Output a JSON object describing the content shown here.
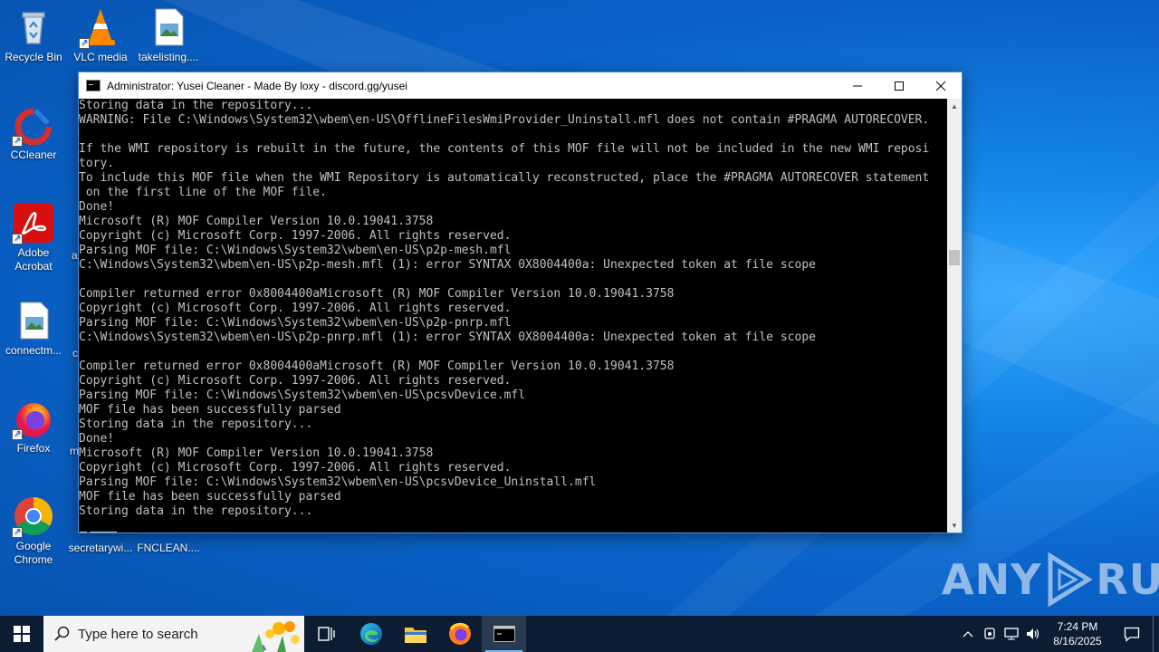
{
  "desktop": {
    "icons": [
      {
        "label": "Recycle Bin"
      },
      {
        "label": "VLC media"
      },
      {
        "label": "takelisting...."
      },
      {
        "label": "CCleaner"
      },
      {
        "label": "Adobe Acrobat"
      },
      {
        "label": "connectm..."
      },
      {
        "label": "Firefox"
      },
      {
        "label": "Google Chrome"
      },
      {
        "label": "secretarywi..."
      },
      {
        "label": "FNCLEAN...."
      }
    ],
    "cut_labels": [
      "a",
      "c",
      "m"
    ]
  },
  "window": {
    "title": "Administrator:  Yusei Cleaner - Made By loxy - discord.gg/yusei",
    "console_lines": [
      "Storing data in the repository...",
      "WARNING: File C:\\Windows\\System32\\wbem\\en-US\\OfflineFilesWmiProvider_Uninstall.mfl does not contain #PRAGMA AUTORECOVER.",
      "",
      "If the WMI repository is rebuilt in the future, the contents of this MOF file will not be included in the new WMI reposi",
      "tory.",
      "To include this MOF file when the WMI Repository is automatically reconstructed, place the #PRAGMA AUTORECOVER statement",
      " on the first line of the MOF file.",
      "Done!",
      "Microsoft (R) MOF Compiler Version 10.0.19041.3758",
      "Copyright (c) Microsoft Corp. 1997-2006. All rights reserved.",
      "Parsing MOF file: C:\\Windows\\System32\\wbem\\en-US\\p2p-mesh.mfl",
      "C:\\Windows\\System32\\wbem\\en-US\\p2p-mesh.mfl (1): error SYNTAX 0X8004400a: Unexpected token at file scope",
      "",
      "Compiler returned error 0x8004400aMicrosoft (R) MOF Compiler Version 10.0.19041.3758",
      "Copyright (c) Microsoft Corp. 1997-2006. All rights reserved.",
      "Parsing MOF file: C:\\Windows\\System32\\wbem\\en-US\\p2p-pnrp.mfl",
      "C:\\Windows\\System32\\wbem\\en-US\\p2p-pnrp.mfl (1): error SYNTAX 0X8004400a: Unexpected token at file scope",
      "",
      "Compiler returned error 0x8004400aMicrosoft (R) MOF Compiler Version 10.0.19041.3758",
      "Copyright (c) Microsoft Corp. 1997-2006. All rights reserved.",
      "Parsing MOF file: C:\\Windows\\System32\\wbem\\en-US\\pcsvDevice.mfl",
      "MOF file has been successfully parsed",
      "Storing data in the repository...",
      "Done!",
      "Microsoft (R) MOF Compiler Version 10.0.19041.3758",
      "Copyright (c) Microsoft Corp. 1997-2006. All rights reserved.",
      "Parsing MOF file: C:\\Windows\\System32\\wbem\\en-US\\pcsvDevice_Uninstall.mfl",
      "MOF file has been successfully parsed",
      "Storing data in the repository..."
    ]
  },
  "watermark": {
    "left": "ANY",
    "right": "RUN"
  },
  "taskbar": {
    "search_placeholder": "Type here to search",
    "clock_time": "7:24 PM",
    "clock_date": "8/16/2025"
  },
  "colors": {
    "console_bg": "#000000",
    "console_text": "#c0c0c0",
    "taskbar_bg": "#0b1c33",
    "desktop_accent": "#0a63c9"
  }
}
